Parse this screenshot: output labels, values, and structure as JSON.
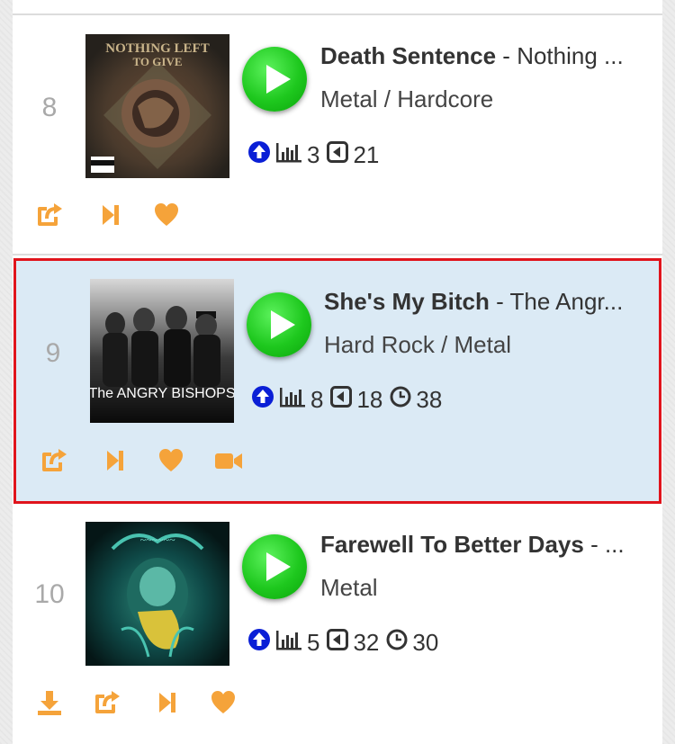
{
  "colors": {
    "accent_orange": "#f5a33a",
    "play_green": "#1ec81e",
    "upvote_blue": "#0a1fd6",
    "highlight_bg": "#dbeaf5",
    "highlight_border": "#e0141c"
  },
  "tracks": [
    {
      "rank": "8",
      "title": "Death Sentence",
      "separator": " - ",
      "artist": "Nothing ...",
      "genre": "Metal / Hardcore",
      "stats": {
        "chart": "3",
        "back": "21"
      },
      "cover_text": "NOTHING LEFT TO GIVE",
      "actions": [
        "share-icon",
        "play-next-icon",
        "heart-icon"
      ]
    },
    {
      "rank": "9",
      "title": "She's My Bitch",
      "separator": " - ",
      "artist": "The Angr...",
      "genre": "Hard Rock / Metal",
      "stats": {
        "chart": "8",
        "back": "18",
        "time": "38"
      },
      "cover_text": "The ANGRY BISHOPS",
      "highlighted": true,
      "actions": [
        "share-icon",
        "play-next-icon",
        "heart-icon",
        "video-icon"
      ]
    },
    {
      "rank": "10",
      "title": "Farewell To Better Days",
      "separator": " - ",
      "artist": "...",
      "genre": "Metal",
      "stats": {
        "chart": "5",
        "back": "32",
        "time": "30"
      },
      "actions": [
        "download-icon",
        "share-icon",
        "play-next-icon",
        "heart-icon"
      ]
    }
  ]
}
